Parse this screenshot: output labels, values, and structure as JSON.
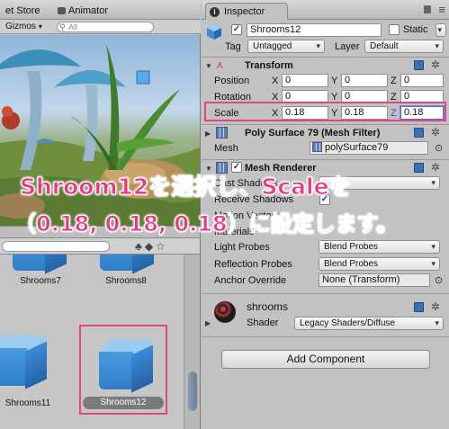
{
  "scene_view": {
    "tabs": [
      "et Store",
      "Animator"
    ],
    "gizmos_label": "Gizmos",
    "search_placeholder": "All"
  },
  "project": {
    "assets": [
      {
        "name": "Shrooms7"
      },
      {
        "name": "Shrooms8"
      },
      {
        "name": "Shrooms11"
      },
      {
        "name": "Shrooms12",
        "selected": true
      }
    ]
  },
  "inspector": {
    "tab_label": "Inspector",
    "object_name": "Shrooms12",
    "static_label": "Static",
    "tag_label": "Tag",
    "tag_value": "Untagged",
    "layer_label": "Layer",
    "layer_value": "Default",
    "transform": {
      "title": "Transform",
      "position": {
        "label": "Position",
        "x": "0",
        "y": "0",
        "z": "0"
      },
      "rotation": {
        "label": "Rotation",
        "x": "0",
        "y": "0",
        "z": "0"
      },
      "scale": {
        "label": "Scale",
        "x": "0.18",
        "y": "0.18",
        "z": "0.18"
      },
      "axis_x": "X",
      "axis_y": "Y",
      "axis_z": "Z"
    },
    "mesh_filter": {
      "title": "Poly Surface 79 (Mesh Filter)",
      "mesh_label": "Mesh",
      "mesh_value": "polySurface79"
    },
    "mesh_renderer": {
      "title": "Mesh Renderer",
      "cast_shadows_label": "Cast Shadows",
      "receive_shadows_label": "Receive Shadows",
      "motion_vectors_label": "Motion Vectors",
      "materials_label": "Materials",
      "light_probes_label": "Light Probes",
      "light_probes_value": "Blend Probes",
      "reflection_probes_label": "Reflection Probes",
      "reflection_probes_value": "Blend Probes",
      "anchor_override_label": "Anchor Override",
      "anchor_override_value": "None (Transform)"
    },
    "material": {
      "name": "shrooms",
      "shader_label": "Shader",
      "shader_value": "Legacy Shaders/Diffuse"
    },
    "add_component_label": "Add Component"
  },
  "overlay": {
    "line1": "Shroom12を選択し、Scaleを",
    "line2": "（0.18, 0.18, 0.18）に設定します。"
  },
  "colors": {
    "highlight": "#e8447a",
    "overlay_text": "#e83a83",
    "focus": "#4a6fd6"
  }
}
